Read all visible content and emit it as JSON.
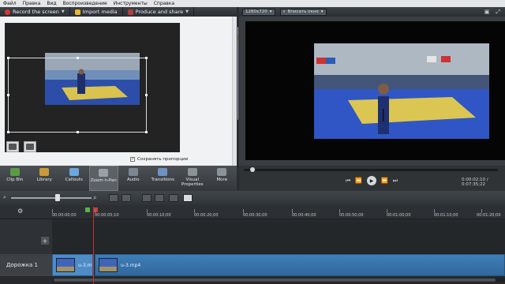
{
  "menu": [
    "Файл",
    "Правка",
    "Вид",
    "Воспроизведение",
    "Инструменты",
    "Справка"
  ],
  "toolbar": {
    "record": "Record the screen",
    "import": "Import media",
    "produce": "Produce and share",
    "record_color": "#d63a2f",
    "import_color": "#e8b832",
    "produce_color": "#b53d3d"
  },
  "preview_toolbar": {
    "size": "1280x720",
    "fit": "Вписать окно",
    "icons": [
      "detach-icon",
      "fullscreen-icon"
    ]
  },
  "clip_bin": {
    "checkbox_label": "Сохранять пропорции",
    "checked": true
  },
  "tabs": [
    {
      "label": "Clip Bin",
      "icon": "film-icon",
      "color": "#5a9c46"
    },
    {
      "label": "Library",
      "icon": "library-icon",
      "color": "#c89a3b"
    },
    {
      "label": "Callouts",
      "icon": "callout-icon",
      "color": "#6aa8dd"
    },
    {
      "label": "Zoom-n-Pan",
      "icon": "zoom-icon",
      "color": "#9aa0a6"
    },
    {
      "label": "Audio",
      "icon": "audio-icon",
      "color": "#7d8792"
    },
    {
      "label": "Transitions",
      "icon": "transition-icon",
      "color": "#6f92c0"
    },
    {
      "label": "Visual Properties",
      "icon": "visual-properties-icon",
      "color": "#8a929a"
    },
    {
      "label": "More",
      "icon": "more-icon",
      "color": "#8a929a"
    }
  ],
  "playback": {
    "timecode": "0:00:02;10 / 0:07:35;22"
  },
  "timeline": {
    "ruler": [
      "00:00:00;00",
      "00:00:05;10",
      "00:00:10;00",
      "00:00:20;00",
      "00:00:30;00",
      "00:00:40;00",
      "00:00:50;00",
      "00:01:00;00",
      "00:01:10;00",
      "00:01:20;00"
    ],
    "track_label": "Дорожка 1",
    "clips": [
      {
        "label": "u-3.m"
      },
      {
        "label": "u-3.mp4"
      }
    ]
  }
}
